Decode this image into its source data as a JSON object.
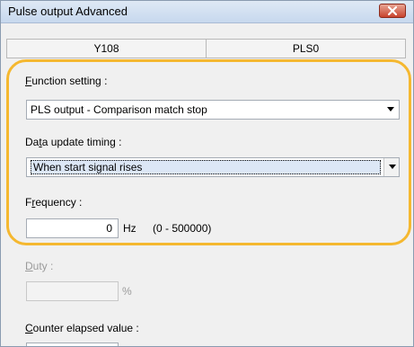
{
  "window": {
    "title": "Pulse output Advanced"
  },
  "tabs": [
    "Y108",
    "PLS0"
  ],
  "function_setting": {
    "label_access": "F",
    "label_rest": "unction setting :",
    "value": "PLS output - Comparison match stop"
  },
  "data_update_timing": {
    "label_pre": "Da",
    "label_access": "t",
    "label_rest": "a update timing :",
    "value": "When start signal rises"
  },
  "frequency": {
    "label_pre": "F",
    "label_access": "r",
    "label_rest": "equency :",
    "value": "0",
    "unit": "Hz",
    "range": "(0 - 500000)"
  },
  "duty": {
    "label_access": "D",
    "label_rest": "uty :",
    "value": "",
    "unit": "%"
  },
  "counter_elapsed": {
    "label_access": "C",
    "label_rest": "ounter elapsed value :"
  },
  "colors": {
    "highlight": "#f5b830",
    "close": "#c8432e"
  },
  "icons": {
    "close": "close-icon",
    "dropdown": "chevron-down-icon"
  }
}
